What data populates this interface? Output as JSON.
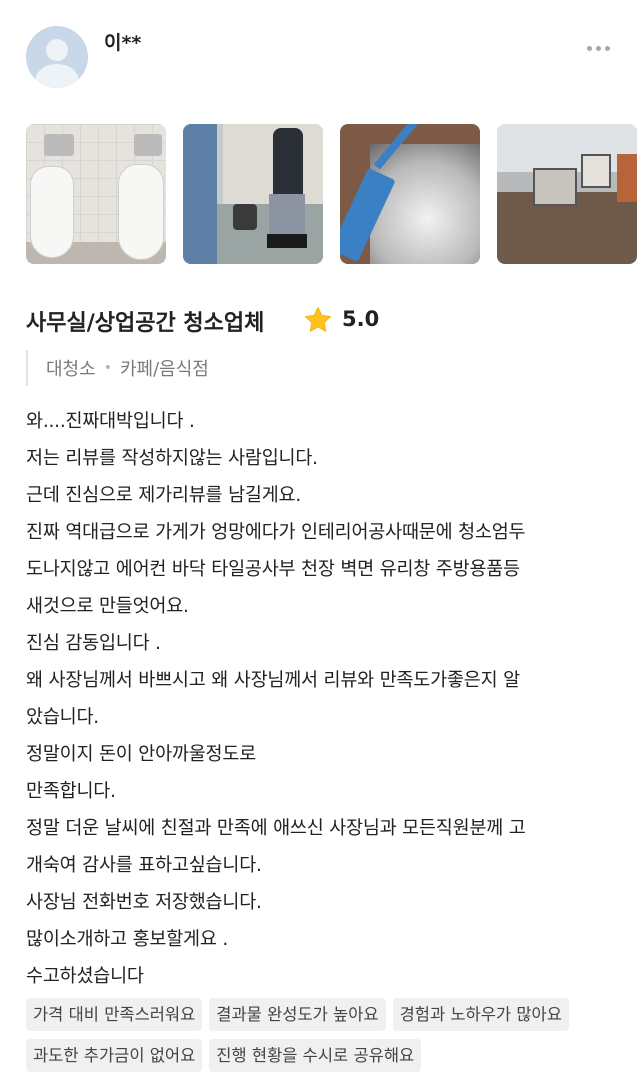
{
  "user": {
    "name": "이**",
    "avatar_icon": "default-user-icon"
  },
  "more_icon": "more-horizontal-icon",
  "photos": [
    {
      "alt": ""
    },
    {
      "alt": ""
    },
    {
      "alt": ""
    },
    {
      "alt": ""
    }
  ],
  "service": {
    "title": "사무실/상업공간 청소업체",
    "rating": "5.0",
    "star_color": "#FFC21A"
  },
  "categories": [
    "대청소",
    "카페/음식점"
  ],
  "review_lines": [
    "와....진짜대박입니다 .",
    "저는 리뷰를 작성하지않는 사람입니다.",
    "근데 진심으로 제가리뷰를 남길게요.",
    "진짜 역대급으로 가게가 엉망에다가 인테리어공사때문에 청소엄두",
    "도나지않고 에어컨 바닥 타일공사부 천장 벽면 유리창 주방용품등",
    "새것으로 만들엇어요.",
    "진심 감동입니다 .",
    "왜 사장님께서 바쁘시고 왜 사장님께서 리뷰와 만족도가좋은지 알",
    "았습니다.",
    "정말이지 돈이 안아까울정도로",
    "만족합니다.",
    "정말 더운 날씨에 친절과 만족에 애쓰신 사장님과 모든직원분께 고",
    "개숙여 감사를 표하고싶습니다.",
    "사장님 전화번호 저장했습니다.",
    "많이소개하고 홍보할게요 .",
    "수고하셨습니다"
  ],
  "tags": [
    "가격 대비 만족스러워요",
    "결과물 완성도가 높아요",
    "경험과 노하우가 많아요",
    "과도한 추가금이 없어요",
    "진행 현황을 수시로 공유해요"
  ]
}
